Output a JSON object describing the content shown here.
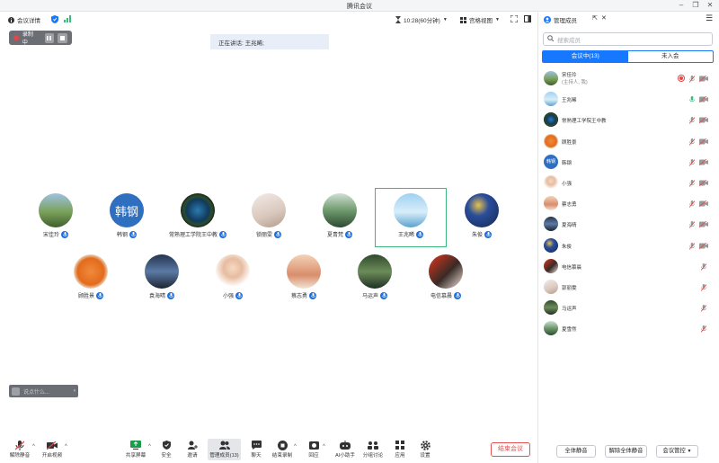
{
  "window": {
    "title": "腾讯会议"
  },
  "meeting_bar": {
    "info_label": "会议详情",
    "timer": "10:28(60分钟)",
    "view_label": "宫格视图"
  },
  "recording": {
    "label": "录制中"
  },
  "speaking": {
    "text": "正在讲话: 王兆晞;"
  },
  "participants": [
    {
      "name": "宋佳玲"
    },
    {
      "name": "韩钢",
      "avatar_text": "韩钢"
    },
    {
      "name": "常熟理工学院王中教"
    },
    {
      "name": "锁丽雯"
    },
    {
      "name": "夏青梵"
    },
    {
      "name": "王兆晞"
    },
    {
      "name": "朱俊"
    },
    {
      "name": "顾胜景"
    },
    {
      "name": "袁海晴"
    },
    {
      "name": "小强"
    },
    {
      "name": "蔡志勇"
    },
    {
      "name": "马运声"
    },
    {
      "name": "电信慕晨"
    }
  ],
  "chat": {
    "placeholder": "说点什么..."
  },
  "toolbar": {
    "mute": "解除静音",
    "video": "开启视频",
    "share": "共享屏幕",
    "security": "安全",
    "invite": "邀请",
    "members": "管理成员(13)",
    "chat": "聊天",
    "record": "结束录制",
    "reactions": "回应",
    "assistant": "AI小助手",
    "breakout": "分组讨论",
    "apps": "应用",
    "settings": "设置",
    "end": "结束会议"
  },
  "panel": {
    "title": "管理成员",
    "search_placeholder": "搜索成员",
    "tab_in": "会议中(13)",
    "tab_out": "未入会",
    "members": [
      {
        "name": "宋佳玲",
        "sub": "(主持人, 我)"
      },
      {
        "name": "王兆晞"
      },
      {
        "name": "常熟理工学院王中教"
      },
      {
        "name": "顾胜景"
      },
      {
        "name": "韩钢",
        "avatar_text": "韩钢"
      },
      {
        "name": "小强"
      },
      {
        "name": "蔡志勇"
      },
      {
        "name": "夏海晴"
      },
      {
        "name": "朱俊"
      },
      {
        "name": "电信慕晨"
      },
      {
        "name": "郭丽雯"
      },
      {
        "name": "马运声"
      },
      {
        "name": "夏雪然"
      }
    ],
    "mute_all": "全体静音",
    "unmute_all": "解除全体静音",
    "controls": "会议管控"
  },
  "colors": {
    "accent": "#1677ff",
    "end": "#e45050",
    "speaker_frame": "#3cba7d"
  }
}
